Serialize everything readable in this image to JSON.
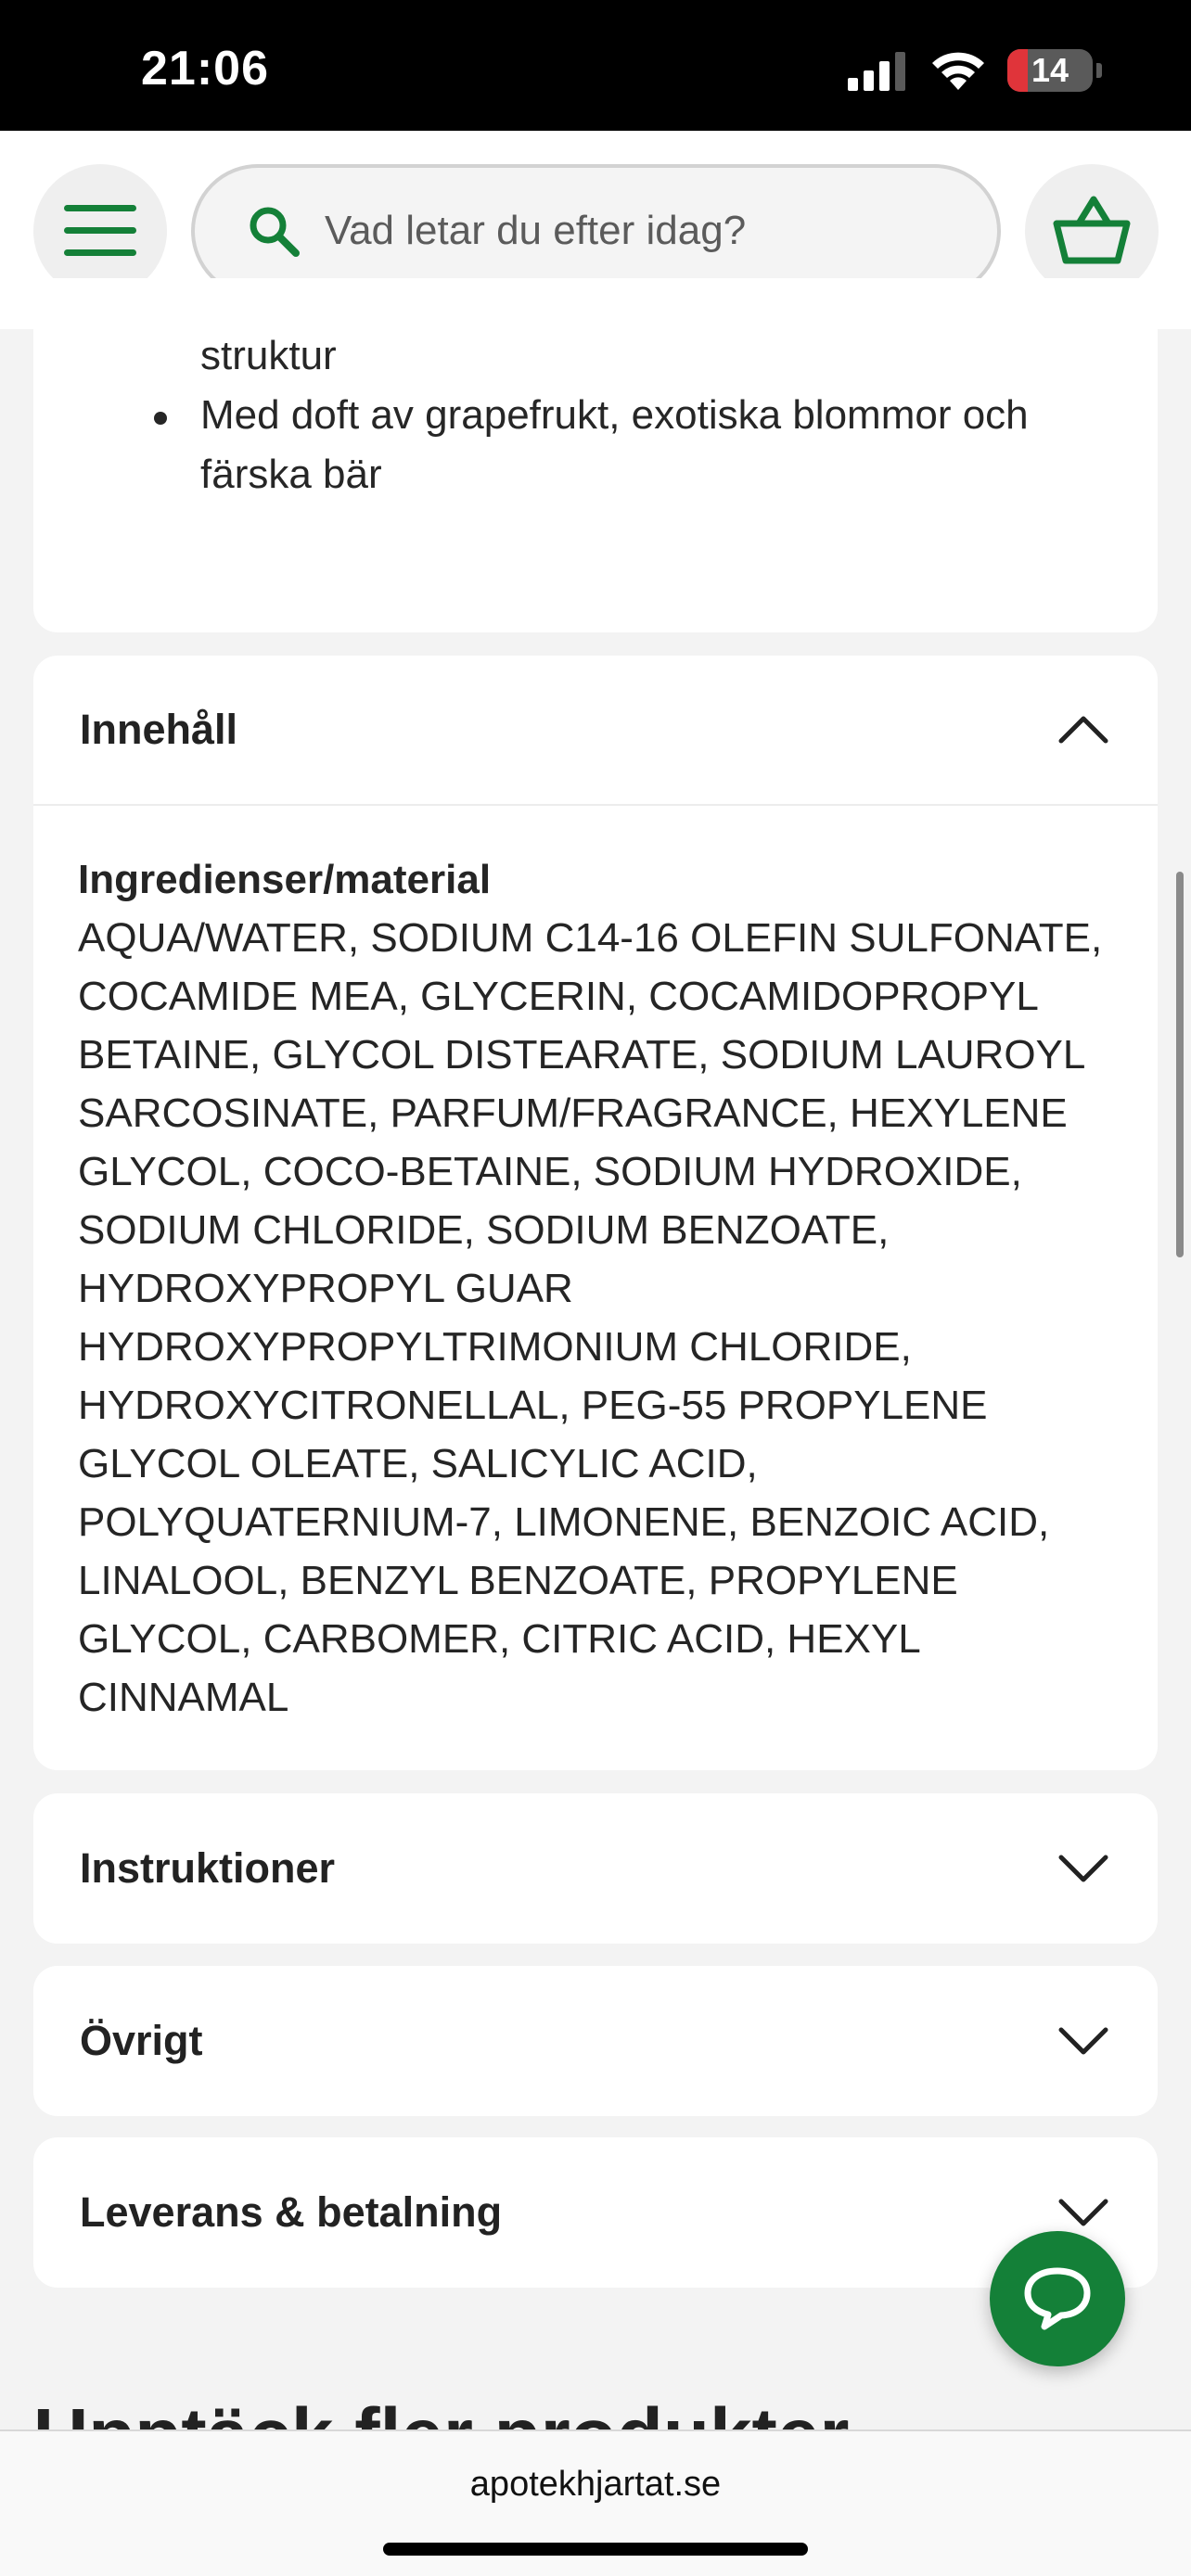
{
  "status_bar": {
    "time": "21:06",
    "battery": "14",
    "battery_color": "#e0343a"
  },
  "header": {
    "menu_icon": "hamburger-menu-icon",
    "search_placeholder": "Vad letar du efter idag?",
    "search_icon": "search-icon",
    "cart_icon": "shopping-basket-icon",
    "accent_color": "#148038"
  },
  "description": {
    "bullets": [
      {
        "text": "struktur",
        "has_bullet": false
      },
      {
        "text": "Med doft av grapefrukt, exotiska blommor och",
        "has_bullet": true
      },
      {
        "text": "färska bär",
        "has_bullet": false
      }
    ]
  },
  "accordions": {
    "content": {
      "title": "Innehåll",
      "expanded": true,
      "ingredients_heading": "Ingredienser/material",
      "ingredients_lines": [
        "AQUA/WATER, SODIUM C14-16 OLEFIN SULFONATE,",
        "COCAMIDE MEA, GLYCERIN, COCAMIDOPROPYL",
        "BETAINE, GLYCOL DISTEARATE, SODIUM LAUROYL",
        "SARCOSINATE, PARFUM/FRAGRANCE, HEXYLENE",
        "GLYCOL, COCO-BETAINE, SODIUM HYDROXIDE,",
        "SODIUM CHLORIDE, SODIUM BENZOATE,",
        "HYDROXYPROPYL GUAR",
        "HYDROXYPROPYLTRIMONIUM CHLORIDE,",
        "HYDROXYCITRONELLAL, PEG-55 PROPYLENE",
        "GLYCOL OLEATE, SALICYLIC ACID,",
        "POLYQUATERNIUM-7, LIMONENE, BENZOIC ACID,",
        "LINALOOL, BENZYL BENZOATE, PROPYLENE",
        "GLYCOL, CARBOMER, CITRIC ACID, HEXYL",
        "CINNAMAL"
      ]
    },
    "instructions": {
      "title": "Instruktioner",
      "expanded": false
    },
    "other": {
      "title": "Övrigt",
      "expanded": false
    },
    "delivery": {
      "title": "Leverans & betalning",
      "expanded": false
    }
  },
  "section": {
    "title": "Upptäck fler produkter"
  },
  "chat": {
    "icon": "chat-bubble-icon"
  },
  "browser": {
    "url": "apotekhjartat.se"
  }
}
